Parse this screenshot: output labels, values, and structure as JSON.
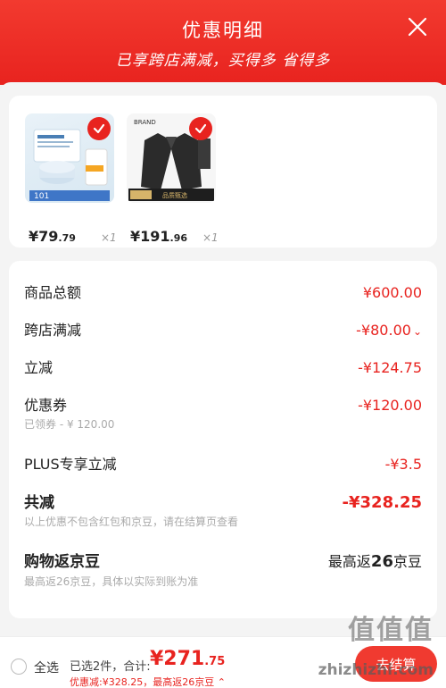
{
  "header": {
    "title": "优惠明细",
    "subtitle": "已享跨店满减，买得多 省得多",
    "close_icon": "close-icon"
  },
  "products": [
    {
      "price_main": "¥79",
      "price_decimal": ".79",
      "qty": "×1",
      "thumb_icon": "skincare-product-icon",
      "badge": "101"
    },
    {
      "price_main": "¥191",
      "price_decimal": ".96",
      "qty": "×1",
      "thumb_icon": "black-blazer-icon"
    }
  ],
  "details": {
    "total_label": "商品总额",
    "total_value": "¥600.00",
    "cross_store_label": "跨店满减",
    "cross_store_value": "-¥80.00",
    "instant_label": "立减",
    "instant_value": "-¥124.75",
    "coupon_label": "优惠券",
    "coupon_value": "-¥120.00",
    "coupon_note": "已领券 - ¥ 120.00",
    "plus_label": "PLUS专享立减",
    "plus_value": "-¥3.5",
    "sum_label": "共减",
    "sum_value": "-¥328.25",
    "sum_note": "以上优惠不包含红包和京豆，请在结算页查看",
    "beans_label": "购物返京豆",
    "beans_prefix": "最高返",
    "beans_num": "26",
    "beans_suffix": "京豆",
    "beans_note": "最高返26京豆，具体以实际到账为准"
  },
  "footer": {
    "select_all": "全选",
    "selected_text": "已选2件，合计:",
    "total_main": "¥271",
    "total_decimal": ".75",
    "discount_text": "优惠减:¥328.25，最高返26京豆",
    "checkout_label": "去结算"
  },
  "watermark": {
    "line1": "值值值",
    "line2": "zhizhizhi.com"
  },
  "colors": {
    "accent": "#e8231f",
    "header": "#f23a2f"
  }
}
